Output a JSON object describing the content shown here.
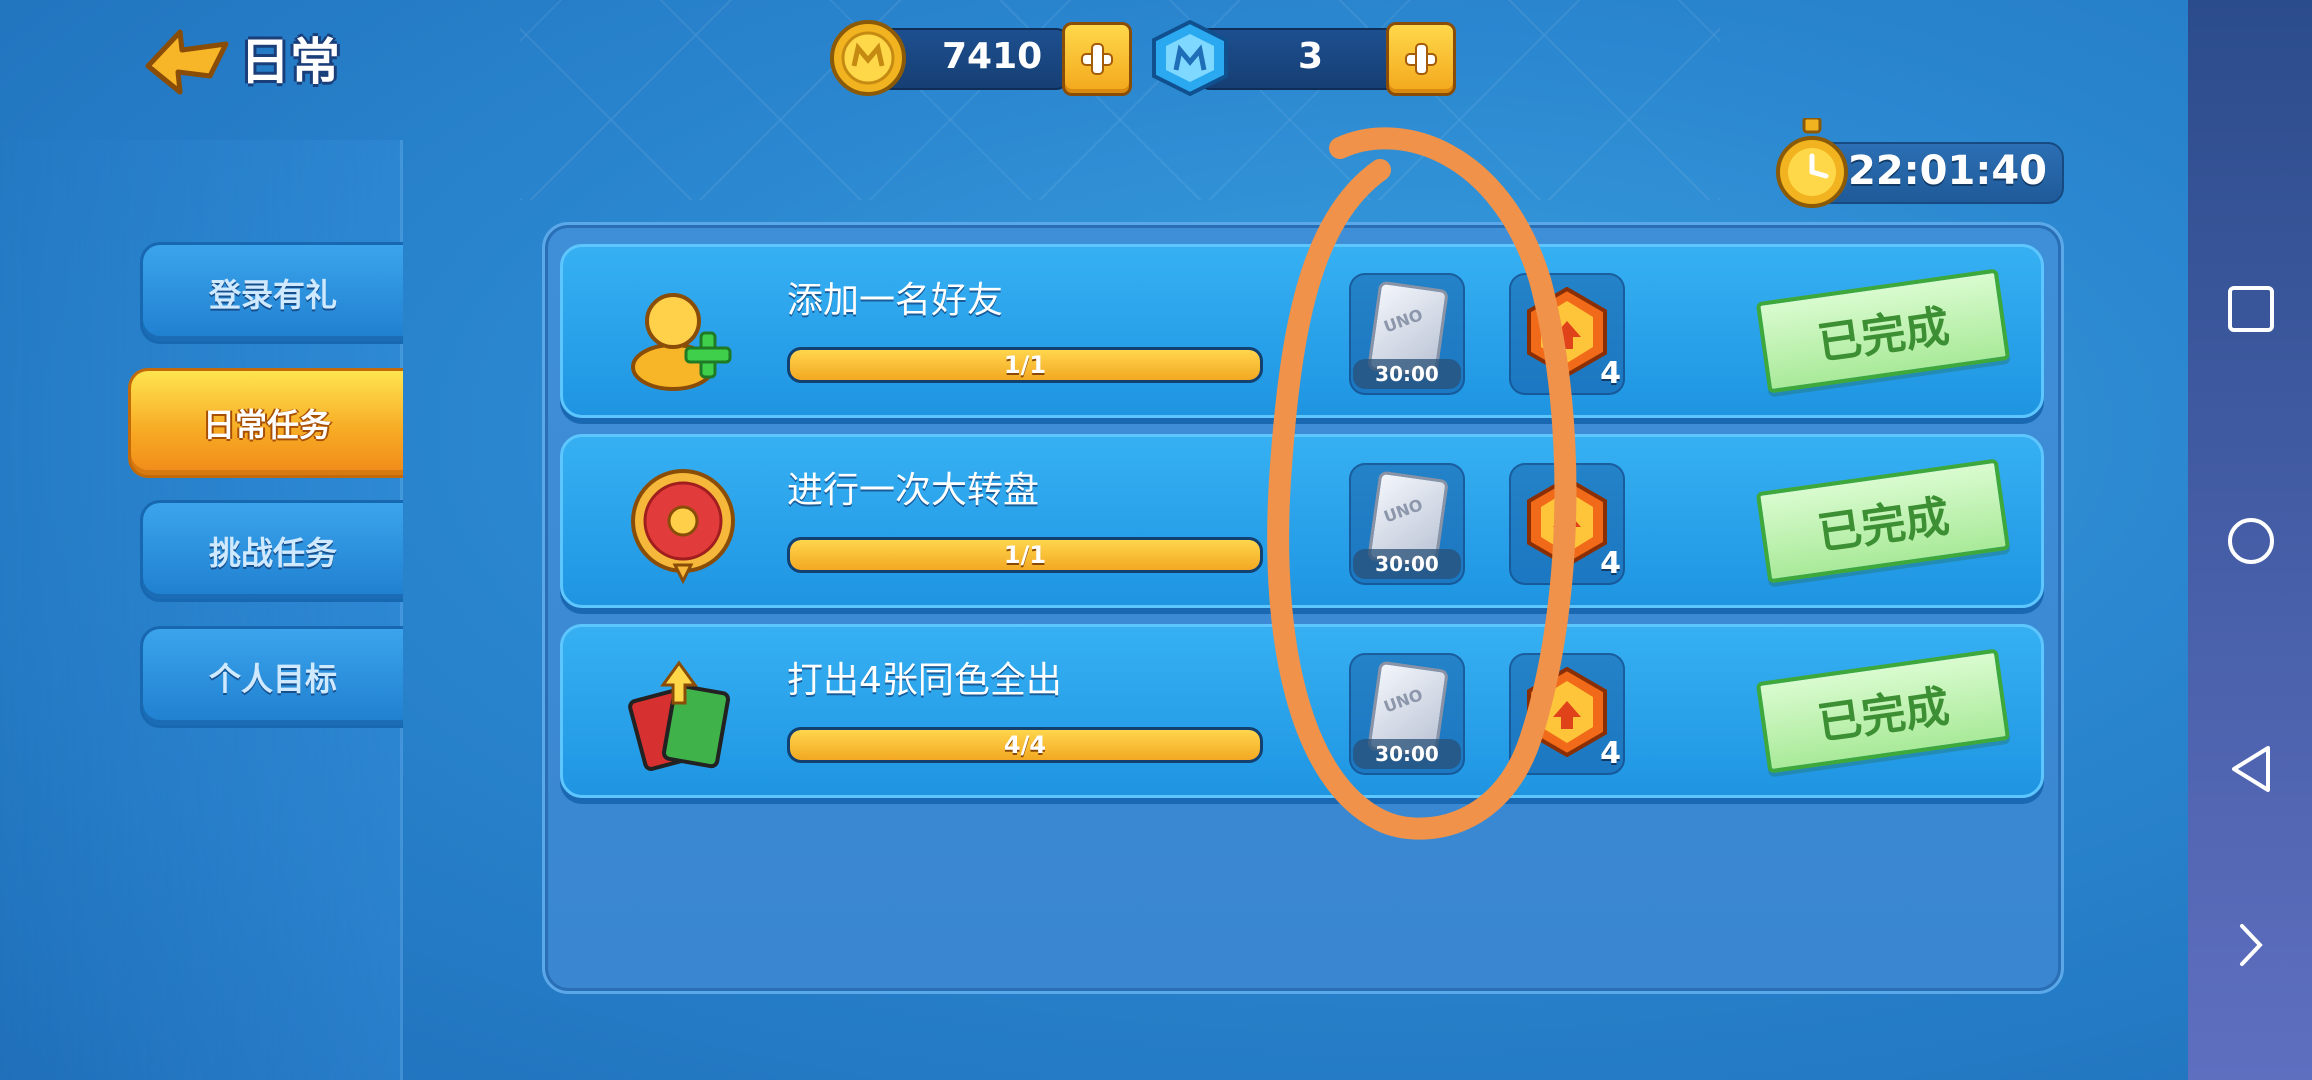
{
  "header": {
    "title": "日常"
  },
  "currency": {
    "coins": {
      "value": "7410",
      "icon": "gold-coin-icon"
    },
    "gems": {
      "value": "3",
      "icon": "blue-gem-icon"
    }
  },
  "timer": {
    "value": "22:01:40"
  },
  "sidebar": {
    "tabs": [
      {
        "label": "登录有礼",
        "active": false
      },
      {
        "label": "日常任务",
        "active": true
      },
      {
        "label": "挑战任务",
        "active": false
      },
      {
        "label": "个人目标",
        "active": false
      }
    ]
  },
  "tasks": [
    {
      "title": "添加一名好友",
      "progress_text": "1/1",
      "progress": 1.0,
      "icon": "add-friend-icon",
      "card_reward": {
        "label": "UNO",
        "timer": "30:00"
      },
      "hex_reward": {
        "count": "4"
      },
      "status": "已完成"
    },
    {
      "title": "进行一次大转盘",
      "progress_text": "1/1",
      "progress": 1.0,
      "icon": "wheel-icon",
      "card_reward": {
        "label": "UNO",
        "timer": "30:00"
      },
      "hex_reward": {
        "count": "4"
      },
      "status": "已完成"
    },
    {
      "title": "打出4张同色全出",
      "progress_text": "4/4",
      "progress": 1.0,
      "icon": "cards-icon",
      "card_reward": {
        "label": "UNO",
        "timer": "30:00"
      },
      "hex_reward": {
        "count": "4"
      },
      "status": "已完成"
    }
  ],
  "colors": {
    "background": "#2a86cf",
    "active_tab": "#f7a823",
    "progress": "#f3a822",
    "done_stamp": "#a9ea99",
    "annotation": "#f0924a"
  }
}
